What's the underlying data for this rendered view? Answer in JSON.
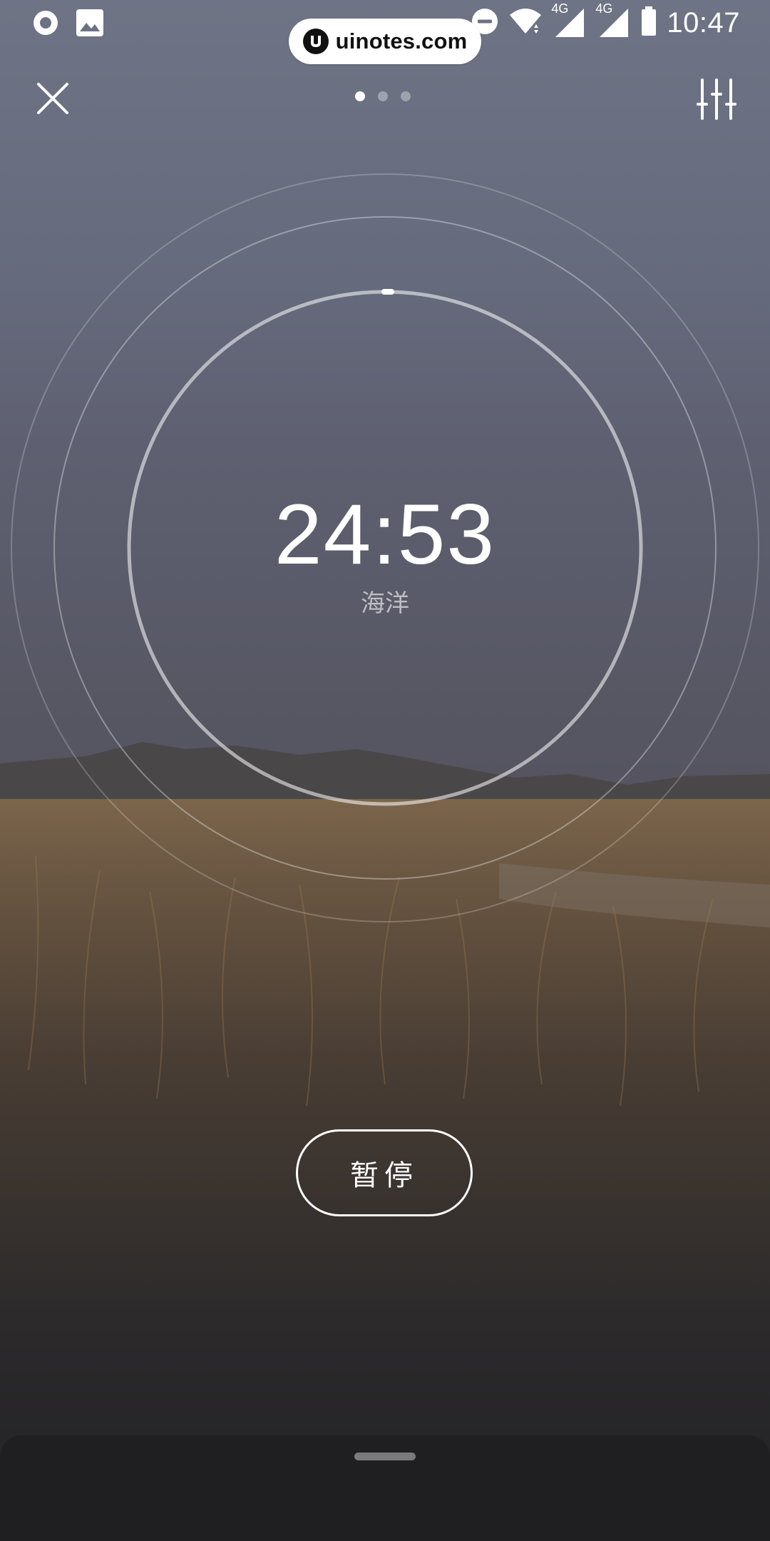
{
  "status_bar": {
    "time": "10:47",
    "network_label_1": "4G",
    "network_label_2": "4G",
    "icons": [
      "record-icon",
      "gallery-icon",
      "dnd-icon",
      "wifi-icon",
      "signal-icon",
      "signal-icon",
      "battery-icon"
    ]
  },
  "watermark": {
    "text": "uinotes.com"
  },
  "header": {
    "close_icon": "close-icon",
    "settings_icon": "sliders-icon",
    "pages": {
      "total": 3,
      "active_index": 0
    }
  },
  "timer": {
    "time": "24:53",
    "sound_name": "海洋"
  },
  "controls": {
    "pause_label": "暂停"
  },
  "colors": {
    "accent": "#ffffff",
    "sheet": "#1f1f22"
  }
}
